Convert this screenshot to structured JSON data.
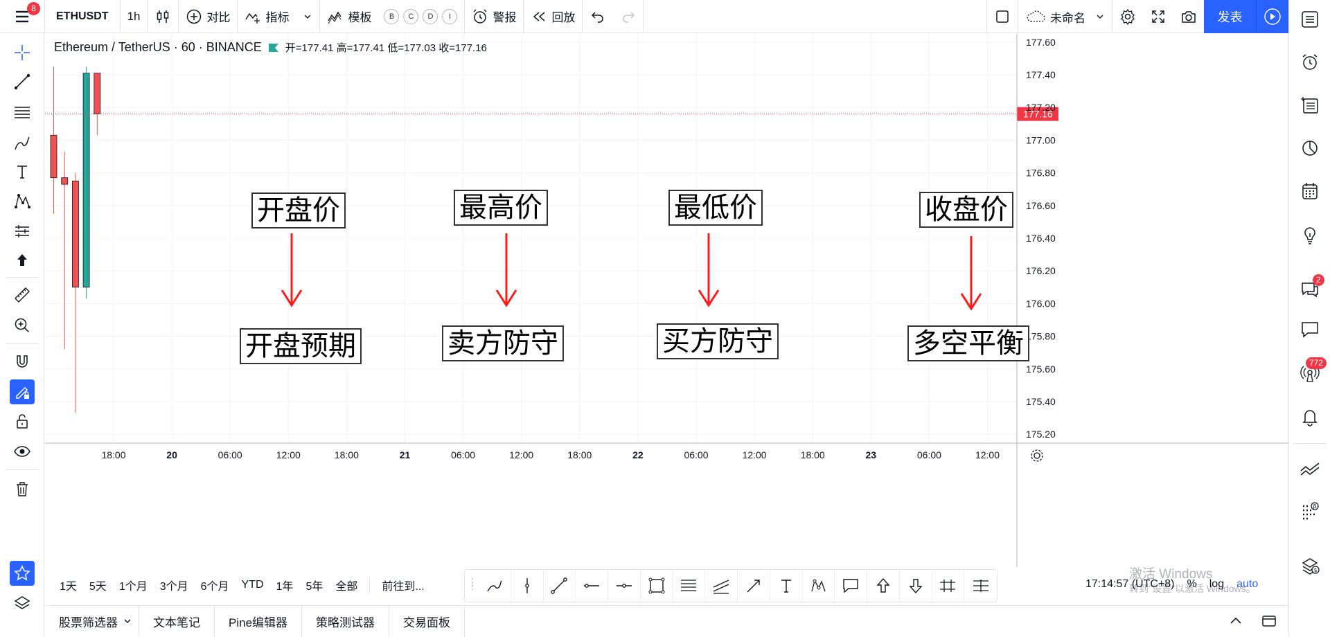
{
  "topbar": {
    "menu_badge": "8",
    "symbol": "ETHUSDT",
    "interval": "1h",
    "compare": "对比",
    "indicators": "指标",
    "templates": "模板",
    "circles": [
      "B",
      "C",
      "D",
      "I"
    ],
    "alert": "警报",
    "replay": "回放",
    "layout_name": "未命名",
    "publish": "发表"
  },
  "legend": {
    "symbol_name": "Ethereum / TetherUS · 60 · BINANCE",
    "ohlc": "开=177.41  高=177.41  低=177.03  收=177.16"
  },
  "annotations": {
    "top": [
      "开盘价",
      "最高价",
      "最低价",
      "收盘价"
    ],
    "bottom": [
      "开盘预期",
      "卖方防守",
      "买方防守",
      "多空平衡"
    ]
  },
  "price_axis": {
    "ticks": [
      "177.60",
      "177.40",
      "177.20",
      "177.00",
      "176.80",
      "176.60",
      "176.40",
      "176.20",
      "176.00",
      "175.80",
      "175.60",
      "175.40",
      "175.20"
    ],
    "last_price": "177.16"
  },
  "time_axis": {
    "ticks": [
      "18:00",
      "20",
      "06:00",
      "12:00",
      "18:00",
      "21",
      "06:00",
      "12:00",
      "18:00",
      "22",
      "06:00",
      "12:00",
      "18:00",
      "23",
      "06:00",
      "12:00"
    ]
  },
  "chart_data": {
    "type": "candlestick",
    "interval": "60",
    "candles": [
      {
        "open": 177.03,
        "high": 177.45,
        "low": 176.55,
        "close": 176.77
      },
      {
        "open": 176.77,
        "high": 176.93,
        "low": 175.72,
        "close": 176.73
      },
      {
        "open": 176.75,
        "high": 176.8,
        "low": 175.33,
        "close": 176.1
      },
      {
        "open": 176.1,
        "high": 177.45,
        "low": 176.03,
        "close": 177.41
      },
      {
        "open": 177.41,
        "high": 177.41,
        "low": 177.03,
        "close": 177.16
      }
    ],
    "ylim": [
      175.15,
      177.65
    ],
    "colors": {
      "up": "#26a69a",
      "down": "#ef5350"
    }
  },
  "ranges": [
    "1天",
    "5天",
    "1个月",
    "3个月",
    "6个月",
    "YTD",
    "1年",
    "5年",
    "全部"
  ],
  "goto": "前往到...",
  "status": {
    "clock": "17:14:57 (UTC+8)",
    "percent": "%",
    "log": "log",
    "auto": "auto"
  },
  "watermark": {
    "line1": "激活 Windows",
    "line2": "转到\"设置\"以激活 Windows。"
  },
  "bottom_tabs": [
    "股票筛选器",
    "文本笔记",
    "Pine编辑器",
    "策略测试器",
    "交易面板"
  ],
  "right_badges": {
    "chat": "2",
    "ideas": "772"
  },
  "colors": {
    "accent": "#2962ff",
    "up": "#26a69a",
    "down": "#ef5350",
    "arrow": "#ff1a1a",
    "last_price": "#f23645"
  }
}
